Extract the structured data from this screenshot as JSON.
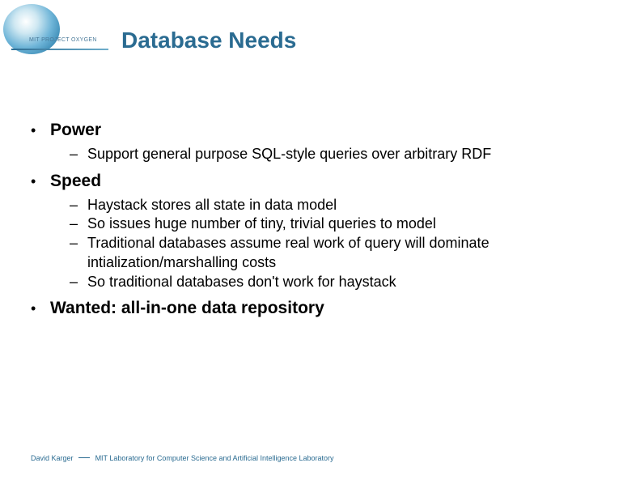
{
  "logo_label": "MIT PROJECT OXYGEN",
  "title": "Database Needs",
  "bullets": [
    {
      "label": "Power",
      "items": [
        "Support general purpose SQL-style queries over arbitrary RDF"
      ]
    },
    {
      "label": "Speed",
      "items": [
        "Haystack stores all state in data model",
        "So issues huge number of tiny, trivial queries to model",
        "Traditional databases assume real work of query will dominate intialization/marshalling costs",
        "So traditional databases don't work for haystack"
      ]
    },
    {
      "label": "Wanted: all-in-one data repository",
      "items": []
    }
  ],
  "footer_author": "David Karger",
  "footer_affiliation": "MIT Laboratory for Computer Science and Artificial Intelligence Laboratory"
}
